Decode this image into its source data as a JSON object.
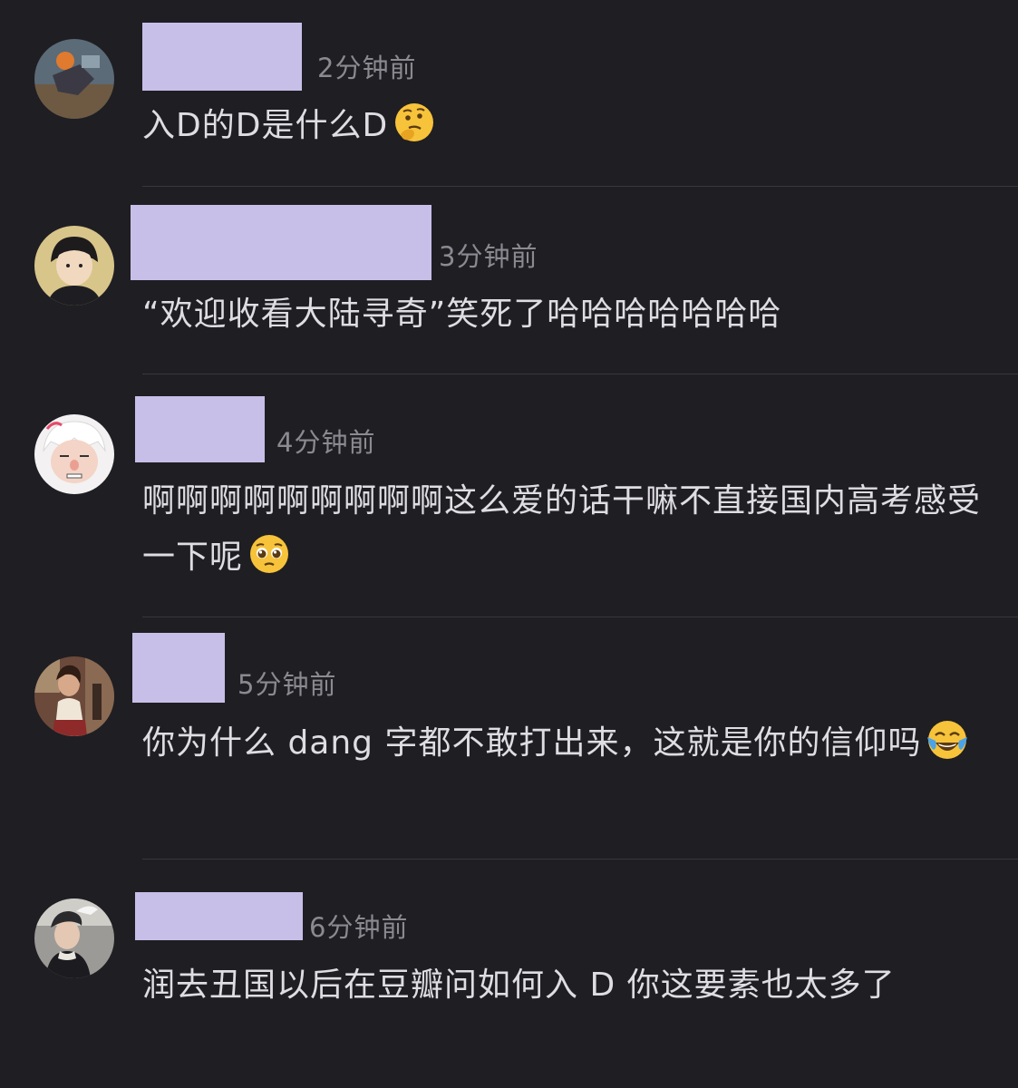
{
  "comments": [
    {
      "time": "2分钟前",
      "text": "入D的D是什么D",
      "emoji": "thinking-face-emoji"
    },
    {
      "time": "3分钟前",
      "text": "“欢迎收看大陆寻奇”笑死了哈哈哈哈哈哈哈",
      "emoji": ""
    },
    {
      "time": "4分钟前",
      "text": "啊啊啊啊啊啊啊啊啊这么爱的话干嘛不直接国内高考感受一下呢",
      "emoji": "pleading-face-emoji"
    },
    {
      "time": "5分钟前",
      "text": "你为什么 dang 字都不敢打出来，这就是你的信仰吗",
      "emoji": "tears-of-joy-emoji"
    },
    {
      "time": "6分钟前",
      "text": "润去丑国以后在豆瓣问如何入 D 你这要素也太多了",
      "emoji": ""
    }
  ],
  "colors": {
    "background": "#1f1e23",
    "name_redaction": "#c8bfe8",
    "timestamp": "#8b8a90",
    "comment_text": "#dedde2",
    "divider": "#38373d"
  }
}
